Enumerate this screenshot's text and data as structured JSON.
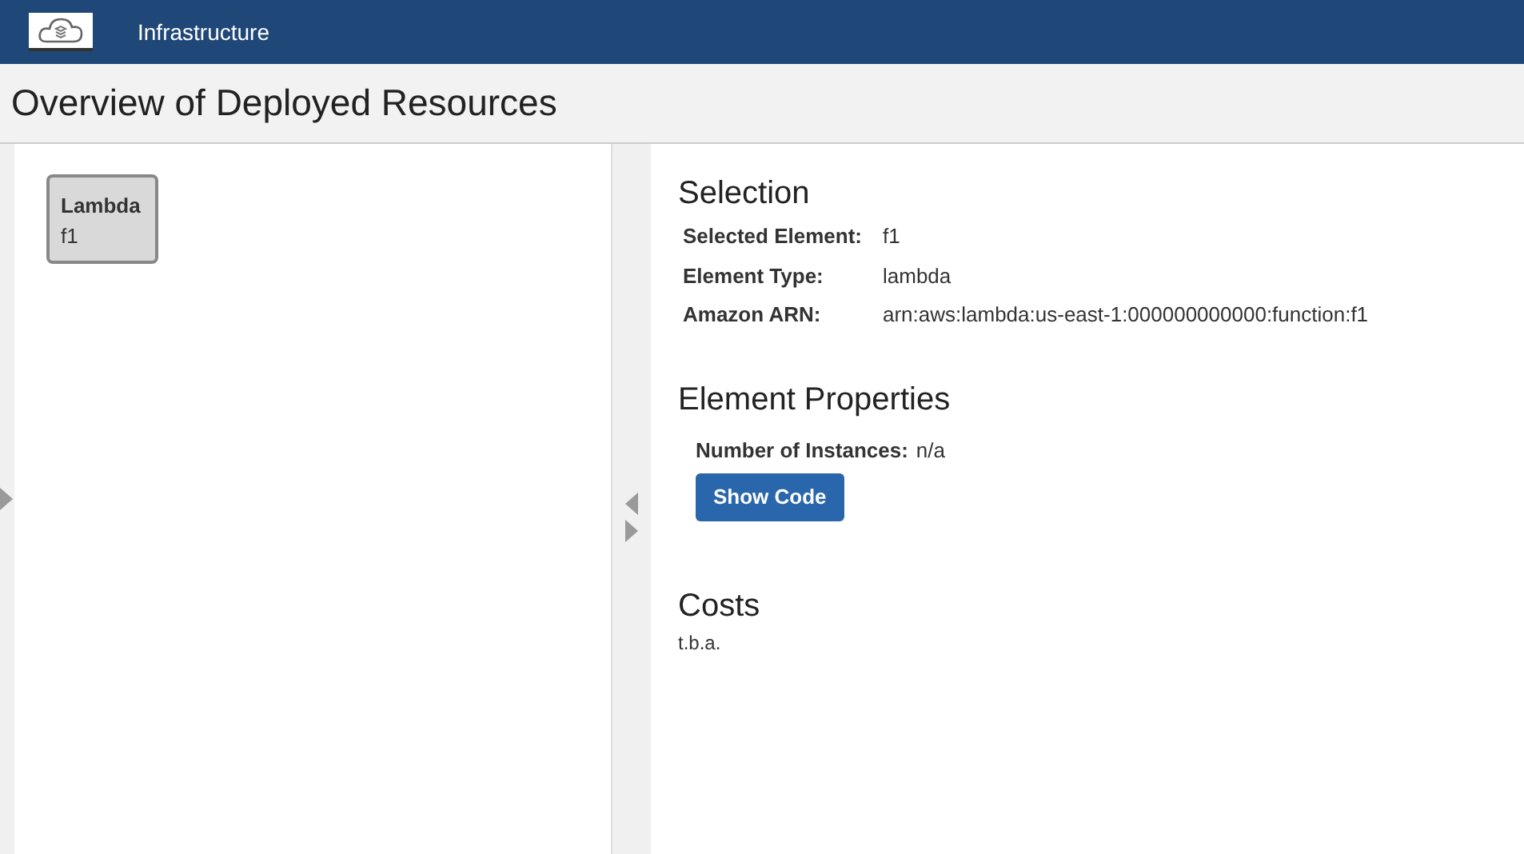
{
  "header": {
    "title": "Infrastructure"
  },
  "page_title": "Overview of Deployed Resources",
  "canvas": {
    "nodes": [
      {
        "type": "Lambda",
        "name": "f1"
      }
    ]
  },
  "selection": {
    "heading": "Selection",
    "fields": [
      {
        "label": "Selected Element:",
        "value": "f1"
      },
      {
        "label": "Element Type:",
        "value": "lambda"
      },
      {
        "label": "Amazon ARN:",
        "value": "arn:aws:lambda:us-east-1:000000000000:function:f1"
      }
    ]
  },
  "properties": {
    "heading": "Element Properties",
    "fields": [
      {
        "label": "Number of Instances:",
        "value": "n/a"
      }
    ],
    "button": "Show Code"
  },
  "costs": {
    "heading": "Costs",
    "text": "t.b.a."
  }
}
